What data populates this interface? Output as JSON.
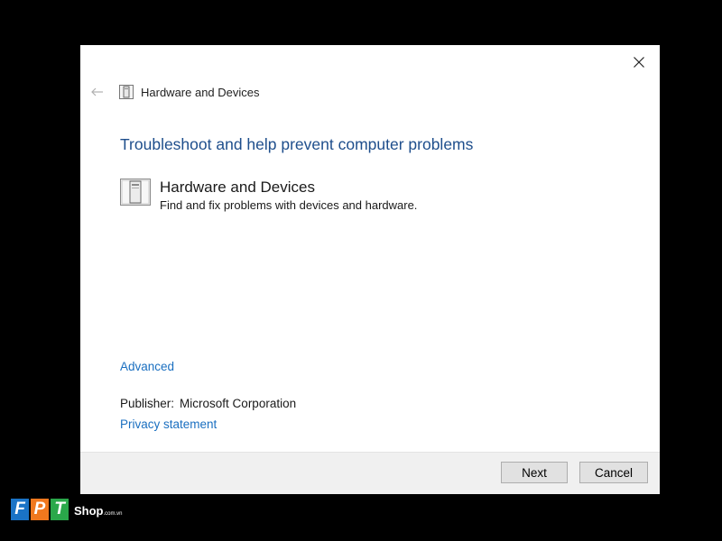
{
  "window": {
    "close_label": "✕",
    "back_label": "←",
    "header_title": "Hardware and Devices",
    "page_title": "Troubleshoot and help prevent computer problems"
  },
  "troubleshooter": {
    "title": "Hardware and Devices",
    "description": "Find and fix problems with devices and hardware.",
    "icon": "hardware-device-icon"
  },
  "links": {
    "advanced": "Advanced",
    "privacy": "Privacy statement"
  },
  "publisher": {
    "label": "Publisher:",
    "value": "Microsoft Corporation"
  },
  "buttons": {
    "next": "Next",
    "cancel": "Cancel"
  },
  "watermark": {
    "letters": [
      "F",
      "P",
      "T"
    ],
    "shop": "Shop",
    "domain": ".com.vn",
    "colors": [
      "#1a73c6",
      "#f0781e",
      "#2aa84a"
    ]
  },
  "colors": {
    "title_blue": "#1e4e8c",
    "link_blue": "#1a6fc0",
    "footer_bg": "#f0f0f0"
  }
}
